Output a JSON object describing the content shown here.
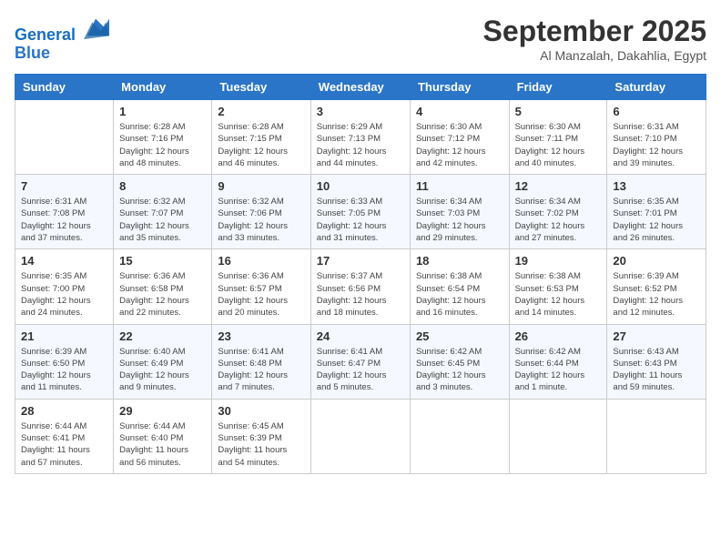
{
  "logo": {
    "line1": "General",
    "line2": "Blue"
  },
  "title": "September 2025",
  "subtitle": "Al Manzalah, Dakahlia, Egypt",
  "weekdays": [
    "Sunday",
    "Monday",
    "Tuesday",
    "Wednesday",
    "Thursday",
    "Friday",
    "Saturday"
  ],
  "weeks": [
    [
      {
        "day": "",
        "info": ""
      },
      {
        "day": "1",
        "info": "Sunrise: 6:28 AM\nSunset: 7:16 PM\nDaylight: 12 hours\nand 48 minutes."
      },
      {
        "day": "2",
        "info": "Sunrise: 6:28 AM\nSunset: 7:15 PM\nDaylight: 12 hours\nand 46 minutes."
      },
      {
        "day": "3",
        "info": "Sunrise: 6:29 AM\nSunset: 7:13 PM\nDaylight: 12 hours\nand 44 minutes."
      },
      {
        "day": "4",
        "info": "Sunrise: 6:30 AM\nSunset: 7:12 PM\nDaylight: 12 hours\nand 42 minutes."
      },
      {
        "day": "5",
        "info": "Sunrise: 6:30 AM\nSunset: 7:11 PM\nDaylight: 12 hours\nand 40 minutes."
      },
      {
        "day": "6",
        "info": "Sunrise: 6:31 AM\nSunset: 7:10 PM\nDaylight: 12 hours\nand 39 minutes."
      }
    ],
    [
      {
        "day": "7",
        "info": "Sunrise: 6:31 AM\nSunset: 7:08 PM\nDaylight: 12 hours\nand 37 minutes."
      },
      {
        "day": "8",
        "info": "Sunrise: 6:32 AM\nSunset: 7:07 PM\nDaylight: 12 hours\nand 35 minutes."
      },
      {
        "day": "9",
        "info": "Sunrise: 6:32 AM\nSunset: 7:06 PM\nDaylight: 12 hours\nand 33 minutes."
      },
      {
        "day": "10",
        "info": "Sunrise: 6:33 AM\nSunset: 7:05 PM\nDaylight: 12 hours\nand 31 minutes."
      },
      {
        "day": "11",
        "info": "Sunrise: 6:34 AM\nSunset: 7:03 PM\nDaylight: 12 hours\nand 29 minutes."
      },
      {
        "day": "12",
        "info": "Sunrise: 6:34 AM\nSunset: 7:02 PM\nDaylight: 12 hours\nand 27 minutes."
      },
      {
        "day": "13",
        "info": "Sunrise: 6:35 AM\nSunset: 7:01 PM\nDaylight: 12 hours\nand 26 minutes."
      }
    ],
    [
      {
        "day": "14",
        "info": "Sunrise: 6:35 AM\nSunset: 7:00 PM\nDaylight: 12 hours\nand 24 minutes."
      },
      {
        "day": "15",
        "info": "Sunrise: 6:36 AM\nSunset: 6:58 PM\nDaylight: 12 hours\nand 22 minutes."
      },
      {
        "day": "16",
        "info": "Sunrise: 6:36 AM\nSunset: 6:57 PM\nDaylight: 12 hours\nand 20 minutes."
      },
      {
        "day": "17",
        "info": "Sunrise: 6:37 AM\nSunset: 6:56 PM\nDaylight: 12 hours\nand 18 minutes."
      },
      {
        "day": "18",
        "info": "Sunrise: 6:38 AM\nSunset: 6:54 PM\nDaylight: 12 hours\nand 16 minutes."
      },
      {
        "day": "19",
        "info": "Sunrise: 6:38 AM\nSunset: 6:53 PM\nDaylight: 12 hours\nand 14 minutes."
      },
      {
        "day": "20",
        "info": "Sunrise: 6:39 AM\nSunset: 6:52 PM\nDaylight: 12 hours\nand 12 minutes."
      }
    ],
    [
      {
        "day": "21",
        "info": "Sunrise: 6:39 AM\nSunset: 6:50 PM\nDaylight: 12 hours\nand 11 minutes."
      },
      {
        "day": "22",
        "info": "Sunrise: 6:40 AM\nSunset: 6:49 PM\nDaylight: 12 hours\nand 9 minutes."
      },
      {
        "day": "23",
        "info": "Sunrise: 6:41 AM\nSunset: 6:48 PM\nDaylight: 12 hours\nand 7 minutes."
      },
      {
        "day": "24",
        "info": "Sunrise: 6:41 AM\nSunset: 6:47 PM\nDaylight: 12 hours\nand 5 minutes."
      },
      {
        "day": "25",
        "info": "Sunrise: 6:42 AM\nSunset: 6:45 PM\nDaylight: 12 hours\nand 3 minutes."
      },
      {
        "day": "26",
        "info": "Sunrise: 6:42 AM\nSunset: 6:44 PM\nDaylight: 12 hours\nand 1 minute."
      },
      {
        "day": "27",
        "info": "Sunrise: 6:43 AM\nSunset: 6:43 PM\nDaylight: 11 hours\nand 59 minutes."
      }
    ],
    [
      {
        "day": "28",
        "info": "Sunrise: 6:44 AM\nSunset: 6:41 PM\nDaylight: 11 hours\nand 57 minutes."
      },
      {
        "day": "29",
        "info": "Sunrise: 6:44 AM\nSunset: 6:40 PM\nDaylight: 11 hours\nand 56 minutes."
      },
      {
        "day": "30",
        "info": "Sunrise: 6:45 AM\nSunset: 6:39 PM\nDaylight: 11 hours\nand 54 minutes."
      },
      {
        "day": "",
        "info": ""
      },
      {
        "day": "",
        "info": ""
      },
      {
        "day": "",
        "info": ""
      },
      {
        "day": "",
        "info": ""
      }
    ]
  ]
}
